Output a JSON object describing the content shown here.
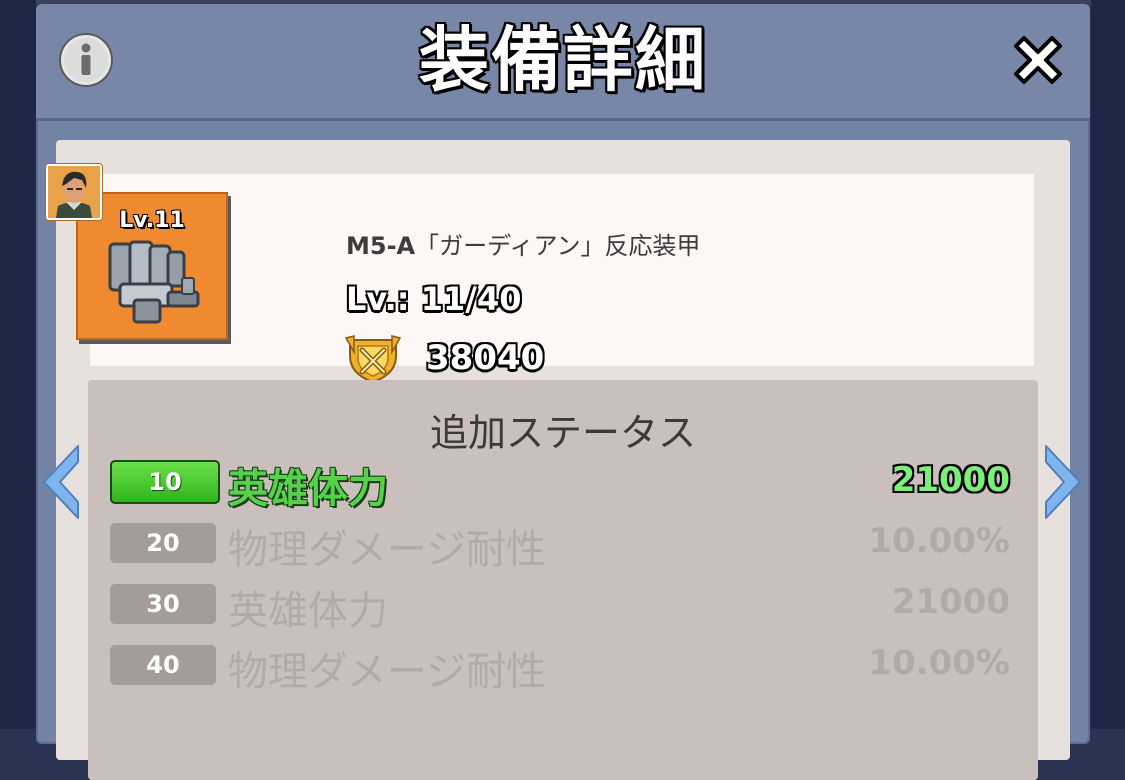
{
  "header": {
    "title": "装備詳細",
    "info_icon": "info-icon",
    "close_icon": "close-icon"
  },
  "item": {
    "icon_level": "Lv.11",
    "name_code": "M5-A",
    "name_rest": "「ガーディアン」反応装甲",
    "level_text": "Lv.: 11/40",
    "power_value": "38040",
    "icon_name": "armor-gauntlet-icon",
    "power_icon": "power-crest-icon",
    "avatar_icon": "hero-avatar-icon",
    "icon_bg_color": "#f08a30"
  },
  "stats": {
    "title": "追加ステータス",
    "rows": [
      {
        "level": "10",
        "label": "英雄体力",
        "value": "21000",
        "active": true
      },
      {
        "level": "20",
        "label": "物理ダメージ耐性",
        "value": "10.00%",
        "active": false
      },
      {
        "level": "30",
        "label": "英雄体力",
        "value": "21000",
        "active": false
      },
      {
        "level": "40",
        "label": "物理ダメージ耐性",
        "value": "10.00%",
        "active": false
      }
    ]
  },
  "nav": {
    "prev_icon": "chevron-left-icon",
    "next_icon": "chevron-right-icon"
  },
  "colors": {
    "active_green": "#53d24a",
    "header_bg": "#7887a8",
    "nav_arrow": "#7fb4ec"
  }
}
